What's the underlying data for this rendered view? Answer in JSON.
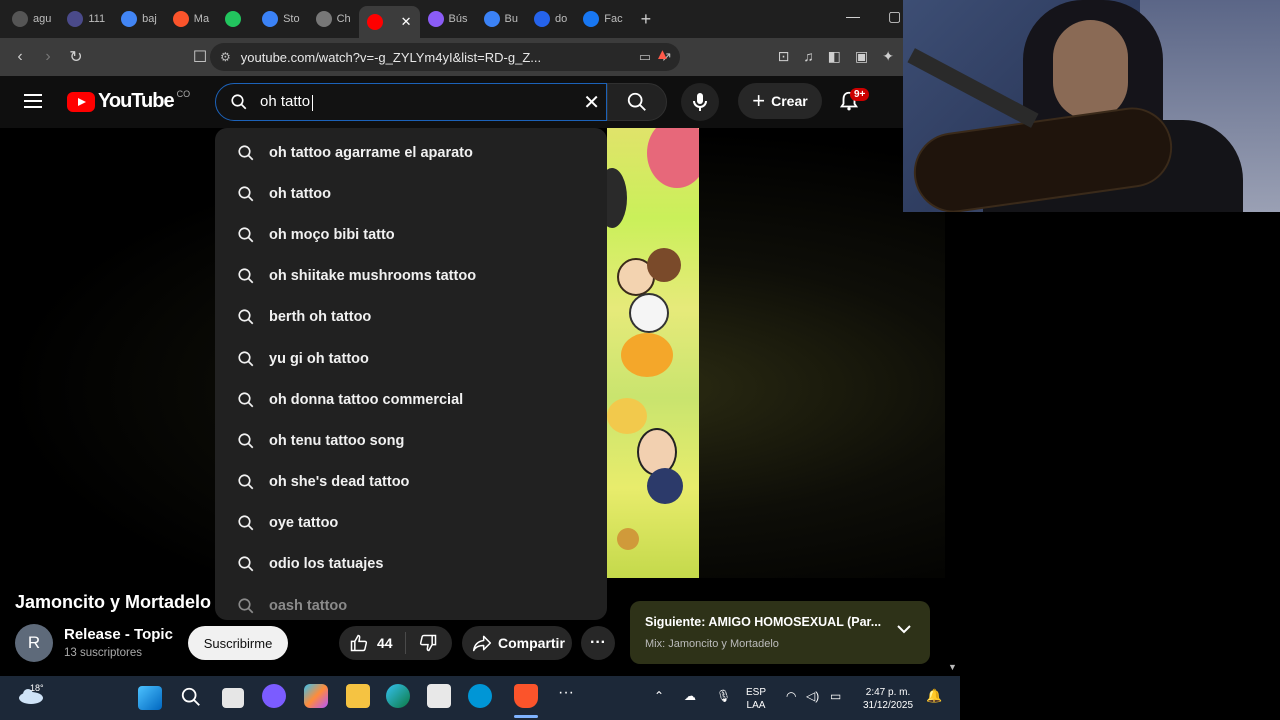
{
  "browser": {
    "tabs": [
      {
        "label": "agu",
        "color": "#555555"
      },
      {
        "label": "111",
        "color": "#4a4a8a"
      },
      {
        "label": "baj",
        "color": "#4285f4"
      },
      {
        "label": "Ma",
        "color": "#fb542b"
      },
      {
        "label": "",
        "color": "#22c55e"
      },
      {
        "label": "Sto",
        "color": "#3b82f6"
      },
      {
        "label": "Ch",
        "color": "#777777"
      },
      {
        "label": "",
        "color": "#ff0000"
      },
      {
        "label": "Bús",
        "color": "#8b5cf6"
      },
      {
        "label": "Bu",
        "color": "#3b82f6"
      },
      {
        "label": "do",
        "color": "#2563eb"
      },
      {
        "label": "Fac",
        "color": "#1877f2"
      }
    ],
    "url": "youtube.com/watch?v=-g_ZYLYm4yI&list=RD-g_Z..."
  },
  "youtube": {
    "logo_text": "YouTube",
    "country_code": "CO",
    "search_value": "oh tatto",
    "create_label": "Crear",
    "notifications_badge": "9+"
  },
  "suggestions": [
    "oh tattoo agarrame el aparato",
    "oh tattoo",
    "oh moço bibi tatto",
    "oh shiitake mushrooms tattoo",
    "berth oh tattoo",
    "yu gi oh tattoo",
    "oh donna tattoo commercial",
    "oh tenu tattoo song",
    "oh she's dead tattoo",
    "oye tattoo",
    "odio los tatuajes",
    "oash tattoo"
  ],
  "video": {
    "title": "Jamoncito y Mortadelo",
    "channel_initial": "R",
    "channel_name": "Release - Topic",
    "subscribers": "13 suscriptores",
    "subscribe_label": "Suscribirme",
    "likes": "44",
    "share_label": "Compartir",
    "more_label": "···",
    "next_title": "Siguiente: AMIGO HOMOSEXUAL (Par...",
    "next_sub": "Mix: Jamoncito y Mortadelo"
  },
  "taskbar": {
    "temperature": "18°",
    "lang_top": "ESP",
    "lang_bottom": "LAA",
    "time": "2:47 p. m.",
    "date": "31/12/2025"
  }
}
